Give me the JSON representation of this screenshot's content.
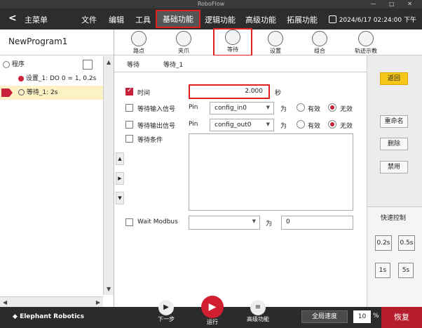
{
  "window": {
    "title": "RoboFlow",
    "controls": "— □ ✕"
  },
  "menubar": {
    "back": "<",
    "home": "主菜单",
    "items": [
      "文件",
      "编辑",
      "工具",
      "基础功能",
      "逻辑功能",
      "高级功能",
      "拓展功能"
    ],
    "active": "基础功能",
    "datetime": "2024/6/17 02:24:00 下午"
  },
  "program": {
    "name": "NewProgram1",
    "tree": [
      {
        "label": "程序",
        "icon": "program-icon"
      },
      {
        "label": "设置_1: DO 0 = 1, 0.2s",
        "icon": "set-icon"
      },
      {
        "label": "等待_1: 2s",
        "icon": "wait-icon",
        "selected": true
      }
    ]
  },
  "toolbar": {
    "items": [
      {
        "label": "路点",
        "icon": "waypoint-icon"
      },
      {
        "label": "夹爪",
        "icon": "gripper-icon"
      },
      {
        "label": "等待",
        "icon": "wait-clock-icon",
        "active": true
      },
      {
        "label": "设置",
        "icon": "set-icon"
      },
      {
        "label": "组合",
        "icon": "group-icon"
      },
      {
        "label": "轨迹示教",
        "icon": "trajectory-icon"
      }
    ]
  },
  "tabs": [
    "等待",
    "等待_1"
  ],
  "form": {
    "time": {
      "label": "时间",
      "value": "2.000",
      "unit": "秒",
      "checked": true
    },
    "wait_input": {
      "label": "等待输入信号",
      "pin_label": "Pin",
      "pin": "config_in0",
      "for": "为",
      "opt1": "有效",
      "opt2": "无效",
      "selected": "无效"
    },
    "wait_output": {
      "label": "等待输出信号",
      "pin_label": "Pin",
      "pin": "config_out0",
      "for": "为",
      "opt1": "有效",
      "opt2": "无效",
      "selected": "无效"
    },
    "condition": {
      "label": "等待条件"
    },
    "modbus": {
      "label": "Wait Modbus",
      "for": "为",
      "value": "0"
    }
  },
  "right": {
    "back": "返回",
    "rename": "重命名",
    "delete": "删除",
    "disable": "禁用",
    "quick": "快速控制",
    "q": [
      "0.2s",
      "0.5s",
      "1s",
      "5s"
    ]
  },
  "bottom": {
    "brand": "Elephant Robotics",
    "next": "下一步",
    "run": "运行",
    "advanced": "高级功能",
    "speed_label": "全局速度",
    "speed": "10",
    "unit": "%",
    "restore": "恢复"
  },
  "colors": {
    "accent_red": "#c8213a",
    "highlight": "#e02020",
    "back_yellow": "#f5c518"
  }
}
